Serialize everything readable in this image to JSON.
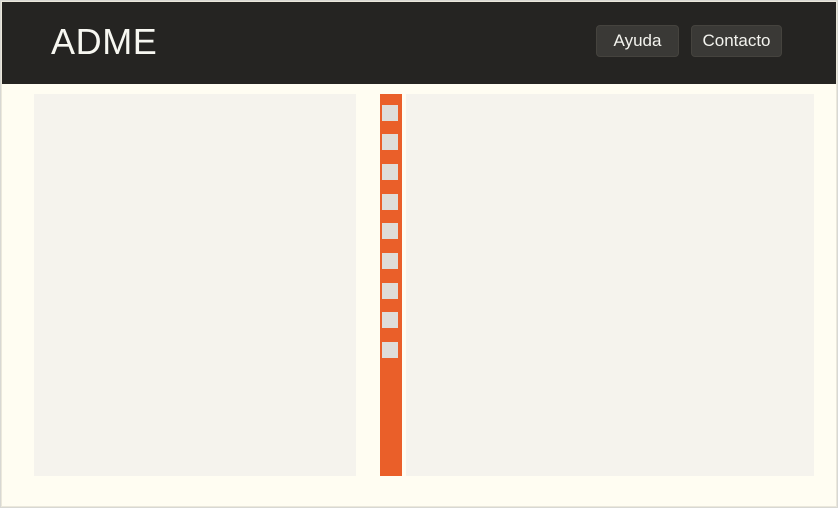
{
  "header": {
    "logo": "ADME",
    "nav": {
      "help": "Ayuda",
      "contact": "Contacto"
    }
  },
  "layout": {
    "left_panel": "empty-panel",
    "right_panel": "empty-panel",
    "rail": {
      "accent": "#ea5f29",
      "square_color": "#dfddd9",
      "item_count": 9
    }
  }
}
